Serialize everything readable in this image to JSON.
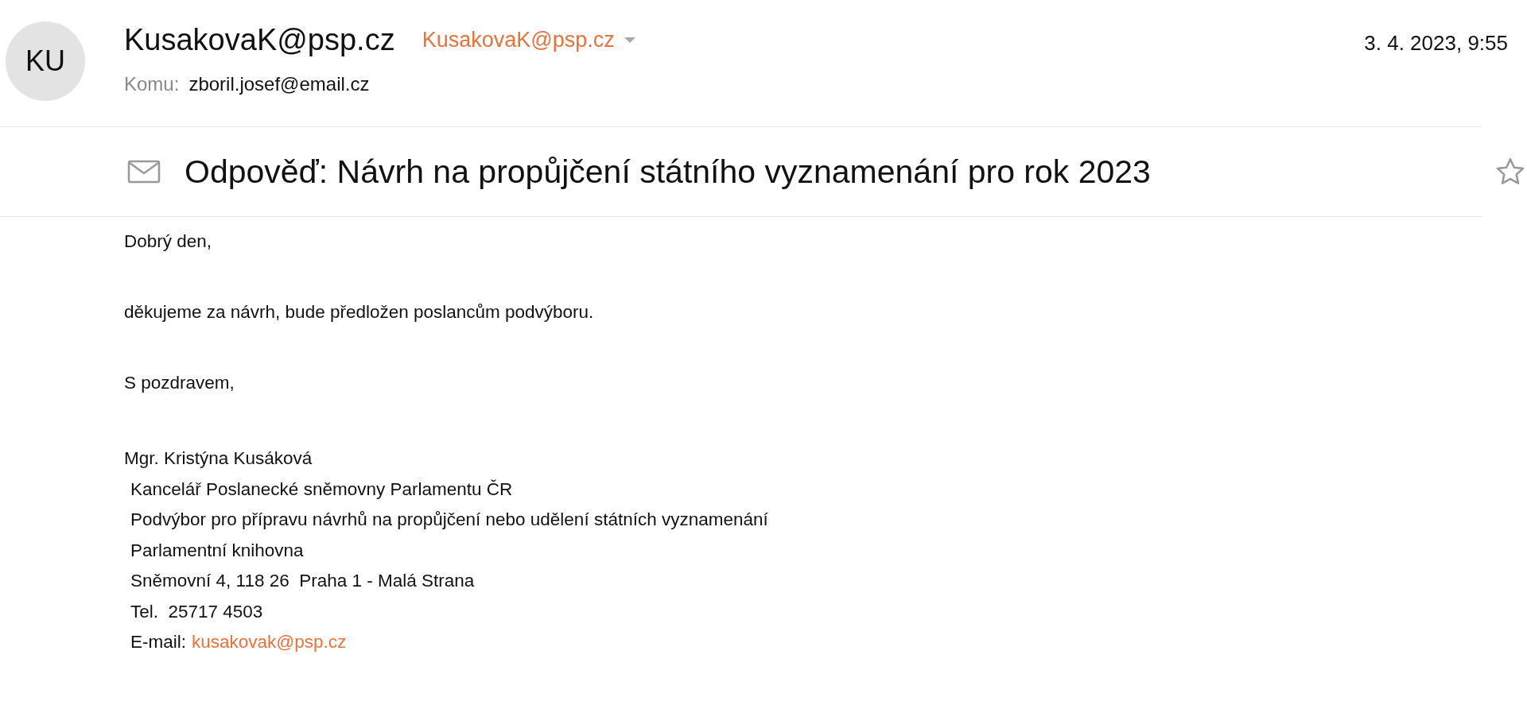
{
  "header": {
    "avatar_initials": "KU",
    "sender_name": "KusakovaK@psp.cz",
    "sender_address": "KusakovaK@psp.cz",
    "to_label": "Komu:",
    "to_address": "zboril.josef@email.cz",
    "date": "3. 4. 2023, 9:55"
  },
  "subject": {
    "text": "Odpověď: Návrh na propůjčení státního vyznamenání pro rok 2023",
    "starred": false
  },
  "body": {
    "paragraphs": [
      "Dobrý den,",
      "děkujeme za návrh, bude předložen poslancům podvýboru.",
      "S pozdravem,"
    ],
    "signature_name": "Mgr. Kristýna Kusáková",
    "signature_lines": [
      "Kancelář Poslanecké sněmovny Parlamentu ČR",
      "Podvýbor pro přípravu návrhů na propůjčení nebo udělení státních vyznamenání",
      "Parlamentní knihovna",
      "Sněmovní 4, 118 26  Praha 1 - Malá Strana",
      "Tel.  25717 4503"
    ],
    "email_label": "E-mail:",
    "email_link": "kusakovak@psp.cz"
  }
}
